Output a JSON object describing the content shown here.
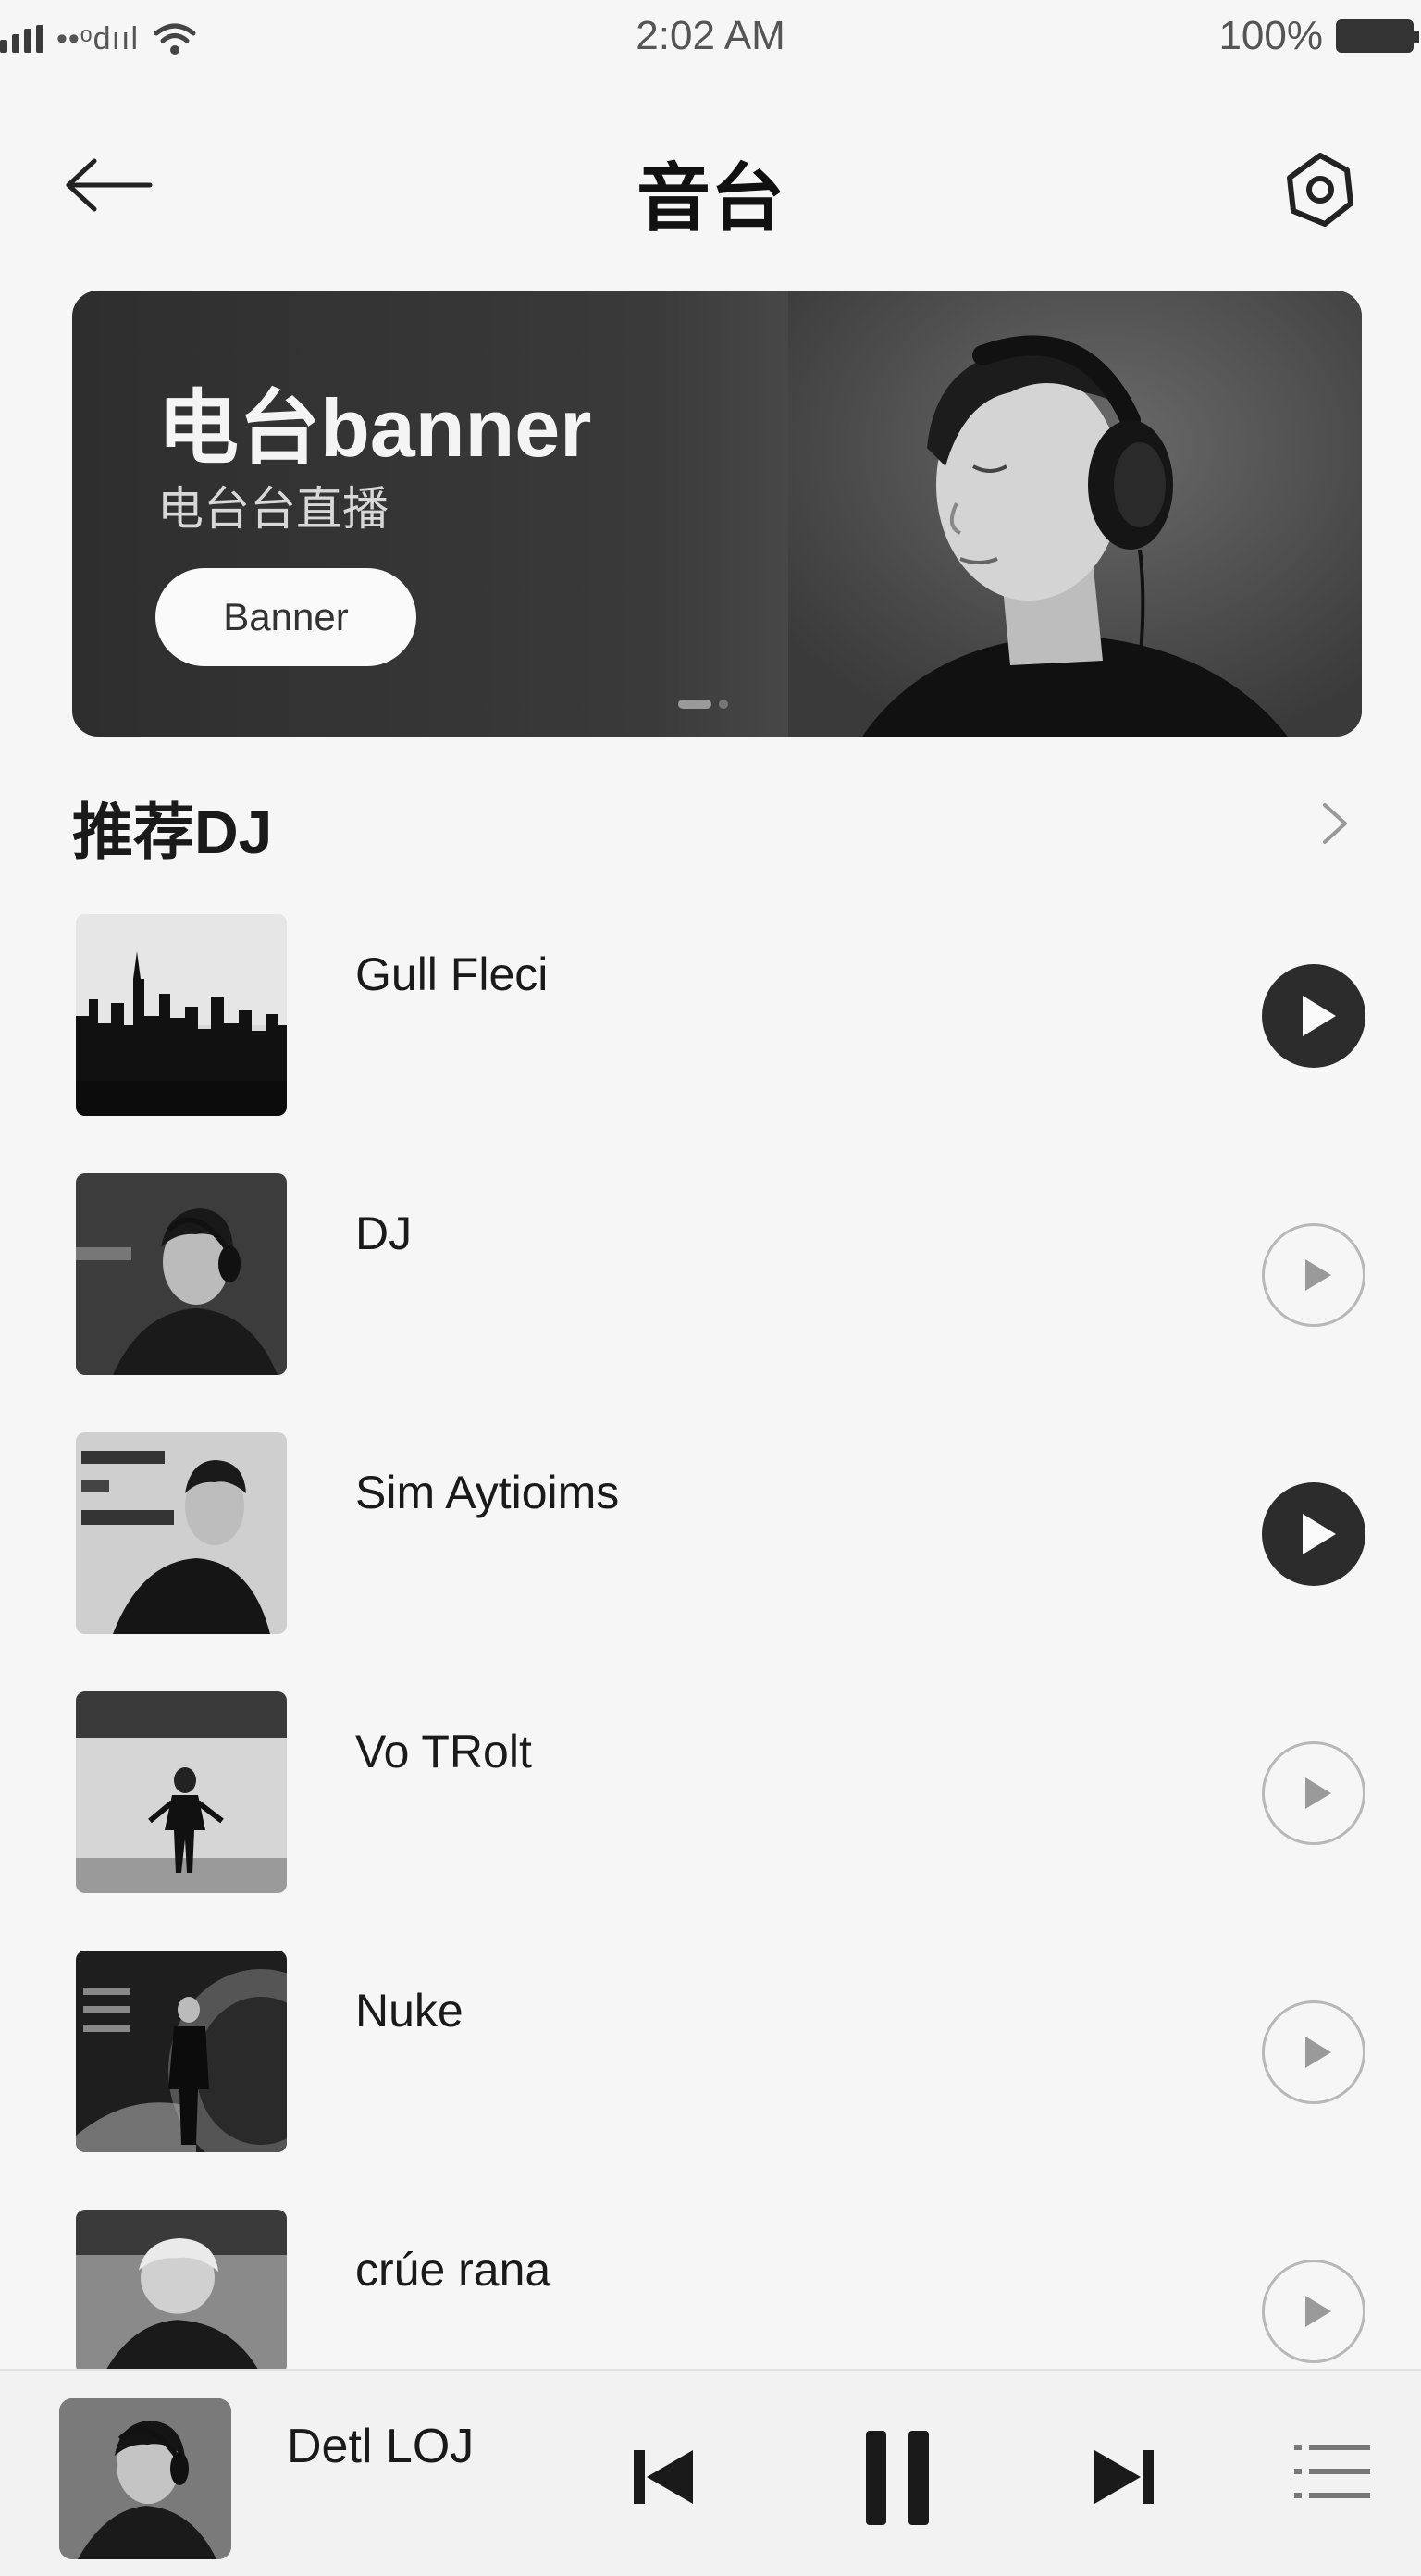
{
  "status_bar": {
    "carrier": "••ᵒdııl",
    "time": "2:02 AM",
    "battery": "100%"
  },
  "nav": {
    "title": "音台",
    "back_icon": "arrow-left-icon",
    "settings_icon": "camera-settings-icon"
  },
  "banner": {
    "title": "电台banner",
    "subtitle": "电台台直播",
    "button_label": "Banner",
    "active_dot": 0,
    "dot_count": 3
  },
  "section": {
    "title": "推荐DJ",
    "more_icon": "chevron-right-icon"
  },
  "dj_list": [
    {
      "name": "Gull Fleci",
      "play_style": "filled"
    },
    {
      "name": "DJ",
      "play_style": "outline"
    },
    {
      "name": "Sim Aytioims",
      "play_style": "filled"
    },
    {
      "name": "Vo TRolt",
      "play_style": "outline"
    },
    {
      "name": "Nuke",
      "play_style": "outline"
    },
    {
      "name": "crúe rana",
      "play_style": "outline"
    }
  ],
  "player": {
    "title": "Detl LOJ",
    "state": "playing"
  },
  "colors": {
    "background": "#f6f6f6",
    "accent_dark": "#2c2c2c",
    "outline_gray": "#b8b8b8"
  }
}
